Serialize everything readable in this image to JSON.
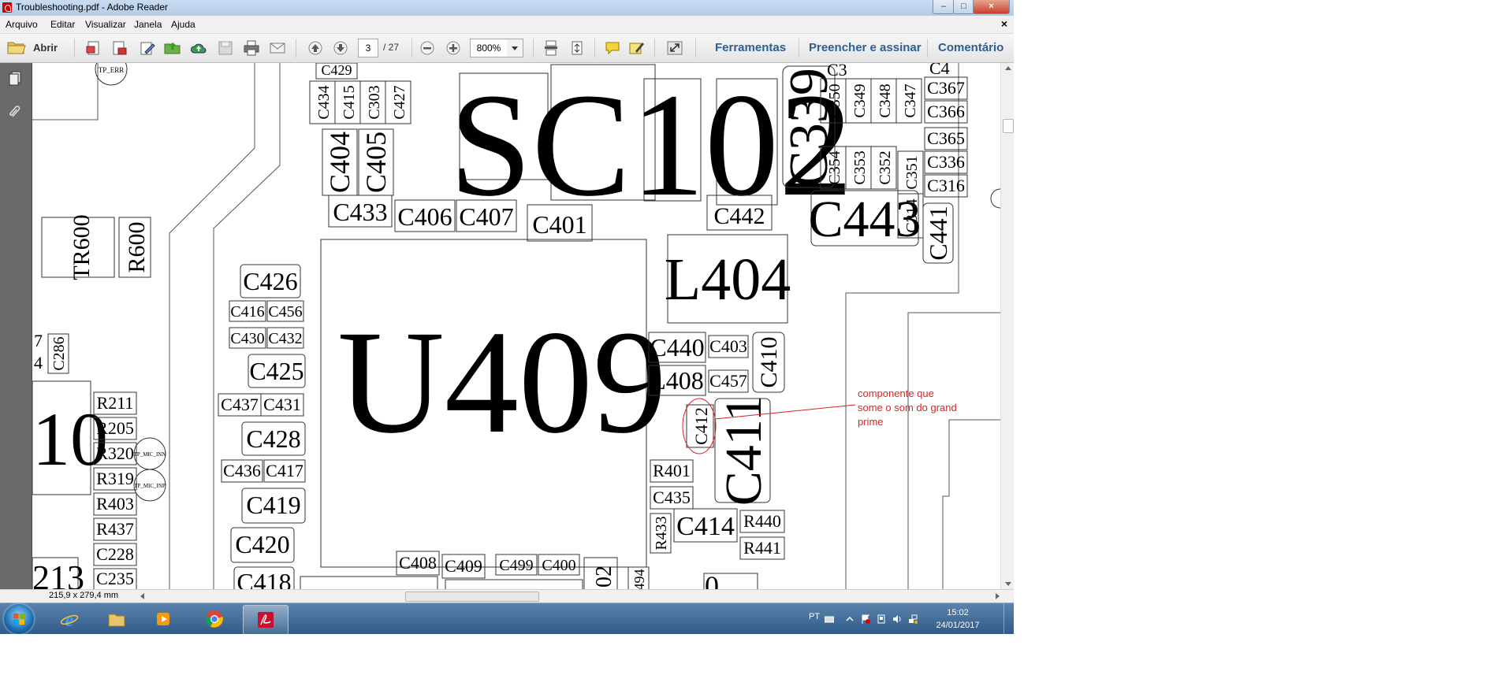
{
  "window": {
    "title": "Troubleshooting.pdf - Adobe Reader",
    "controls": {
      "minimize": "–",
      "maximize": "□",
      "close": "×"
    }
  },
  "menu": {
    "items": [
      "Arquivo",
      "Editar",
      "Visualizar",
      "Janela",
      "Ajuda"
    ],
    "close_doc": "×"
  },
  "toolbar": {
    "open_label": "Abrir",
    "current_page": "3",
    "total_pages": "/ 27",
    "zoom": "800%",
    "links": [
      "Ferramentas",
      "Preencher e assinar",
      "Comentário"
    ]
  },
  "document": {
    "components": {
      "u409": "U409",
      "sc102": "SC102",
      "l404": "L404",
      "c443": "C443",
      "c339": "C339",
      "c411": "C411",
      "c412": "C412",
      "c414": "C414",
      "c440": "C440",
      "l408": "L408",
      "c403": "C403",
      "c457": "C457",
      "c410": "C410",
      "r401": "R401",
      "c435": "C435",
      "r433": "R433",
      "r440": "R440",
      "r441": "R441",
      "c401": "C401",
      "c442": "C442",
      "c433": "C433",
      "c406": "C406",
      "c407": "C407",
      "c404": "C404",
      "c405": "C405",
      "c434": "C434",
      "c415": "C415",
      "c303": "C303",
      "c427": "C427",
      "c429": "C429",
      "c426": "C426",
      "c416": "C416",
      "c456": "C456",
      "c430": "C430",
      "c432": "C432",
      "c425": "C425",
      "c437": "C437",
      "c431": "C431",
      "c428": "C428",
      "c436": "C436",
      "c417": "C417",
      "c419": "C419",
      "c420": "C420",
      "c418": "C418",
      "c408": "C408",
      "c409": "C409",
      "c499": "C499",
      "c400": "C400",
      "c350": "C350",
      "c349": "C349",
      "c348": "C348",
      "c347": "C347",
      "c354": "C354",
      "c353": "C353",
      "c352": "C352",
      "c351": "C351",
      "c314": "C314",
      "c441": "C441",
      "c367": "C367",
      "c366": "C366",
      "c365": "C365",
      "c336": "C336",
      "c316": "C316",
      "tr600": "TR600",
      "r600": "R600",
      "c286": "C286",
      "r211": "R211",
      "r205": "R205",
      "r320": "R320",
      "r319": "R319",
      "r403": "R403",
      "r437": "R437",
      "c228": "C228",
      "c235": "C235",
      "tp_err": "TP_ERR",
      "tp_mic": "TP_MIC_INN",
      "tp_mic2": "TP_MIC_INP",
      "partial_10": "10",
      "partial_213": "213",
      "partial_02": "02",
      "partial_494": "494",
      "partial_7": "7",
      "partial_4": "4",
      "partial_c3": "C3",
      "partial_c0": "0",
      "partial_u4": "U4",
      "partial_c4": "C4",
      "partial_c4b": "C4"
    },
    "annotation": {
      "line1": "componente que",
      "line2": "some o som do grand",
      "line3": "prime"
    },
    "colors": {
      "annotation": "#e02020"
    }
  },
  "status": {
    "page_size": "215,9 x 279,4 mm"
  },
  "taskbar": {
    "apps": [
      "internet-explorer",
      "windows-explorer",
      "media-player",
      "chrome",
      "adobe-reader"
    ],
    "language": "PT",
    "time": "15:02",
    "date": "24/01/2017"
  }
}
